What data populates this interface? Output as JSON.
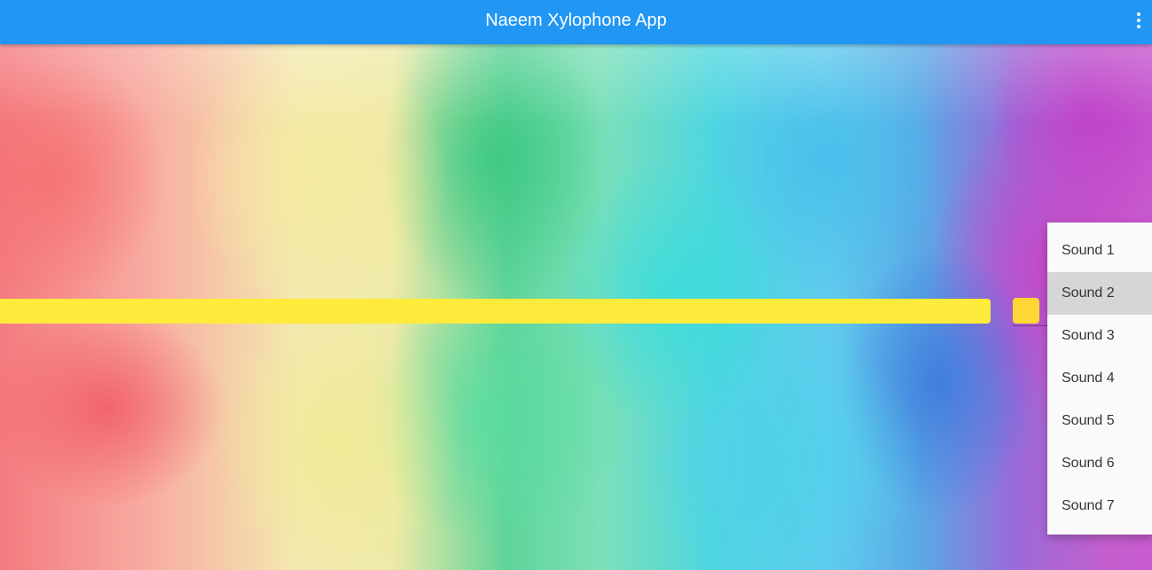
{
  "appbar": {
    "title": "Naeem Xylophone App",
    "overflow_icon": "more-vert-icon",
    "color": "#2196f3"
  },
  "bar": {
    "color": "#ffeb3b"
  },
  "dropdown": {
    "swatch_color": "#fdd835",
    "selected_value": "Sound 2",
    "options": [
      {
        "label": "Sound 1"
      },
      {
        "label": "Sound 2"
      },
      {
        "label": "Sound 3"
      },
      {
        "label": "Sound 4"
      },
      {
        "label": "Sound 5"
      },
      {
        "label": "Sound 6"
      },
      {
        "label": "Sound 7"
      }
    ]
  }
}
